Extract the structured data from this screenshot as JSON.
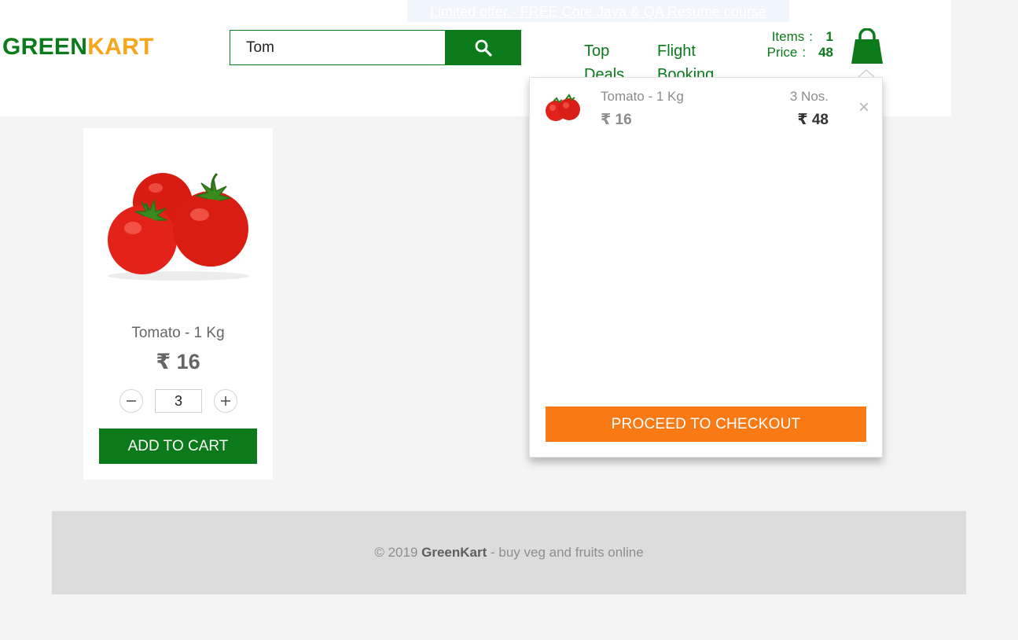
{
  "promo": {
    "text": "Limited offer - FREE Core Java & QA Resume course"
  },
  "brand": {
    "part1": "GREEN",
    "part2": "KART"
  },
  "search": {
    "value": "Tom",
    "button_icon": "search-icon"
  },
  "nav": {
    "top_deals": {
      "line1": "Top",
      "line2": "Deals"
    },
    "flight_booking": {
      "line1": "Flight",
      "line2": "Booking"
    }
  },
  "cart_info": {
    "items_label": "Items",
    "items_value": "1",
    "price_label": "Price",
    "price_value": "48",
    "separator": ":"
  },
  "cart_preview": {
    "items": [
      {
        "name": "Tomato - 1 Kg",
        "price": "₹ 16",
        "quantity": "3 Nos.",
        "amount": "₹ 48",
        "remove": "×"
      }
    ],
    "checkout_label": "PROCEED TO CHECKOUT"
  },
  "products": [
    {
      "name": "Tomato - 1 Kg",
      "price": "₹ 16",
      "quantity": "3",
      "add_label": "ADD TO CART"
    }
  ],
  "footer": {
    "prefix": "© 2019 ",
    "brand": "GreenKart",
    "suffix": " - buy veg and fruits online"
  },
  "colors": {
    "green": "#0b7a1a",
    "orange": "#f97a15",
    "brand_orange": "#f8a51c",
    "tomato_red": "#e2231a"
  }
}
